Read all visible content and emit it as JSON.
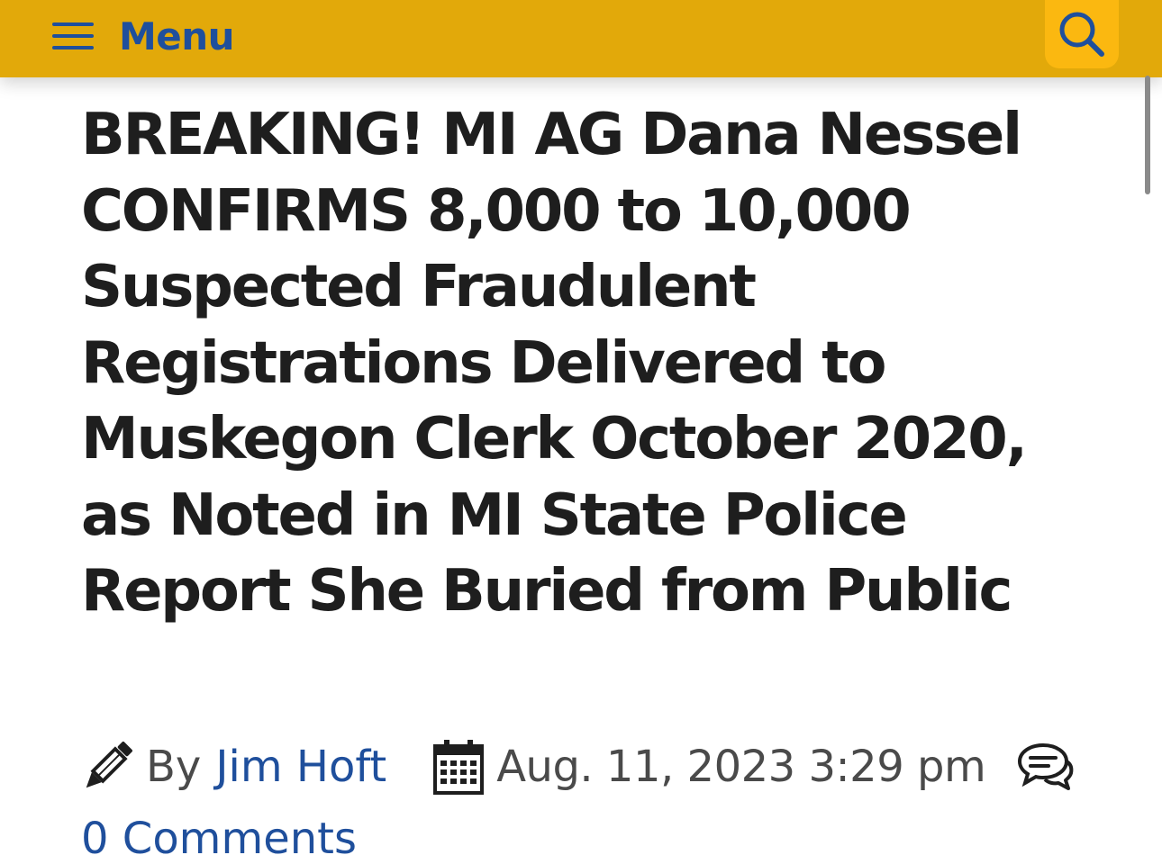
{
  "header": {
    "menu_label": "Menu",
    "menu_icon": "hamburger-icon",
    "search_icon": "search-icon",
    "bar_color": "#e2a90a",
    "search_button_color": "#fbb810",
    "accent_color": "#1f4f9c"
  },
  "article": {
    "headline": "BREAKING! MI AG Dana Nessel CONFIRMS 8,000 to 10,000 Suspected Fraudulent Registrations Delivered to Muskegon Clerk October 2020, as Noted in MI State Police Report She Buried from Public",
    "byline_prefix": "By",
    "author": "Jim Hoft",
    "date": "Aug. 11, 2023 3:29 pm",
    "comments_label": "0 Comments",
    "author_icon": "pencil-icon",
    "date_icon": "calendar-icon",
    "comments_icon": "comments-icon"
  }
}
